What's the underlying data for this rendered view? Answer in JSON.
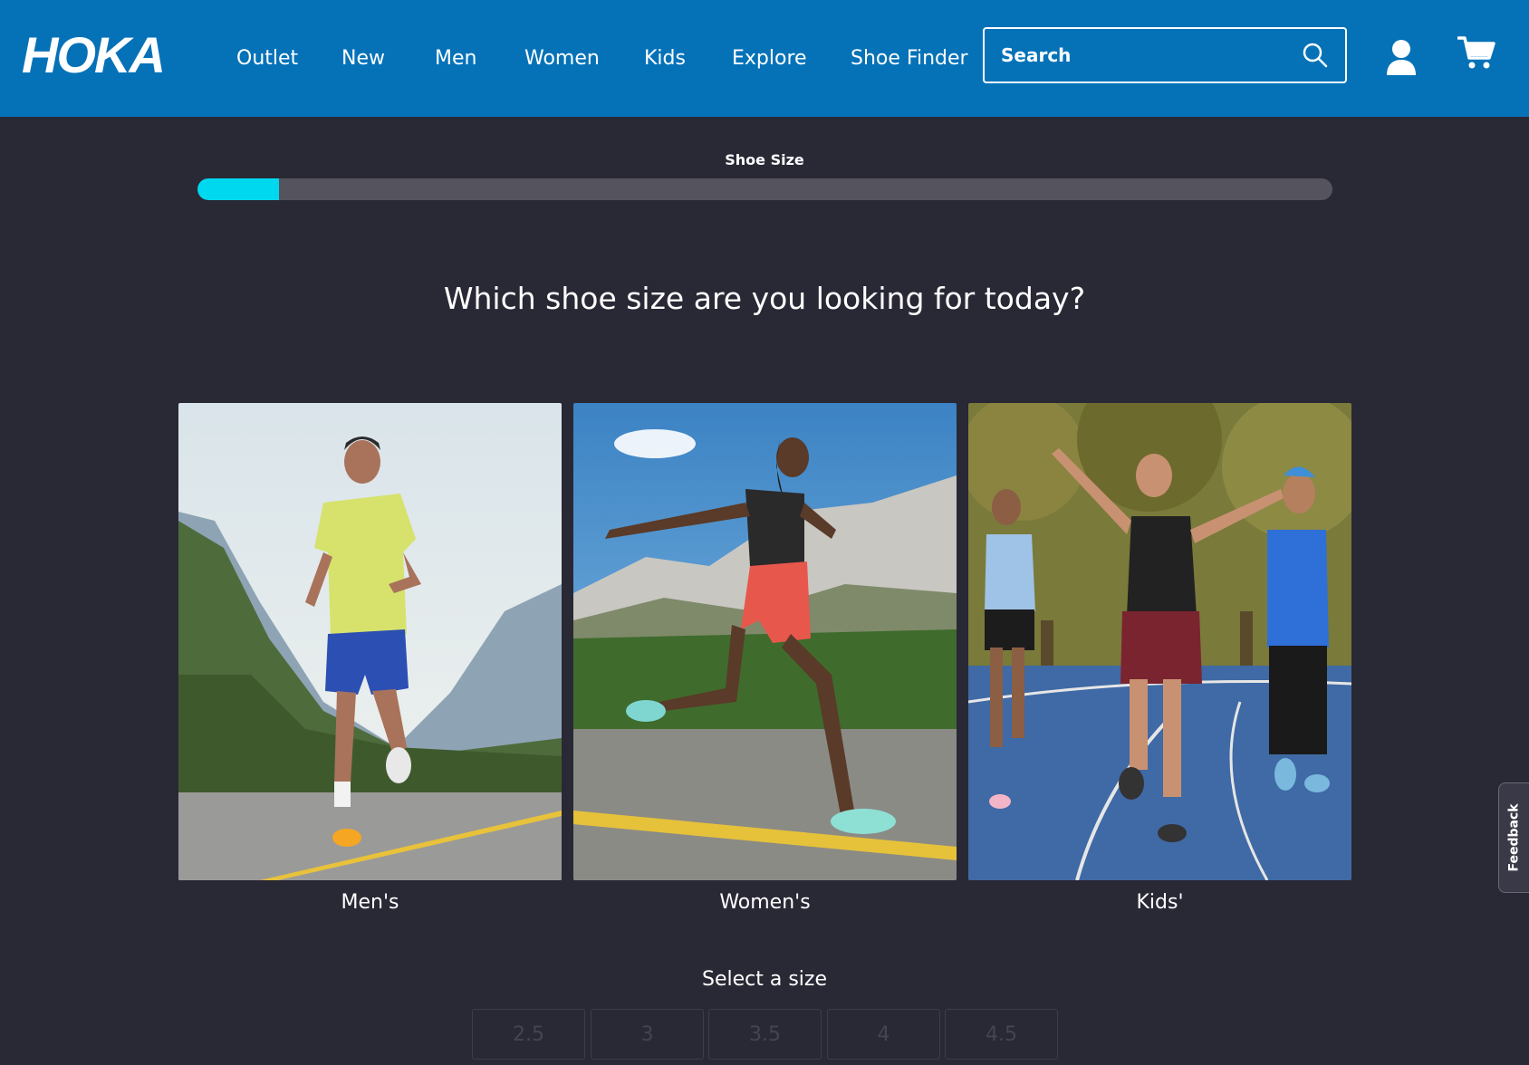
{
  "header": {
    "logo_text": "HOKA",
    "nav": [
      "Outlet",
      "New",
      "Men",
      "Women",
      "Kids",
      "Explore",
      "Shoe Finder"
    ],
    "search_placeholder": "Search"
  },
  "progress": {
    "label": "Shoe Size",
    "fraction": 0.072
  },
  "question": "Which shoe size are you looking for today?",
  "categories": [
    {
      "label": "Men's"
    },
    {
      "label": "Women's"
    },
    {
      "label": "Kids'"
    }
  ],
  "sizes": {
    "label": "Select a size",
    "options": [
      "2.5",
      "3",
      "3.5",
      "4",
      "4.5"
    ]
  },
  "feedback_label": "Feedback",
  "colors": {
    "header_bg": "#0572b8",
    "page_bg": "#292835",
    "progress_fill": "#00d8ef",
    "progress_track": "#55545e"
  }
}
